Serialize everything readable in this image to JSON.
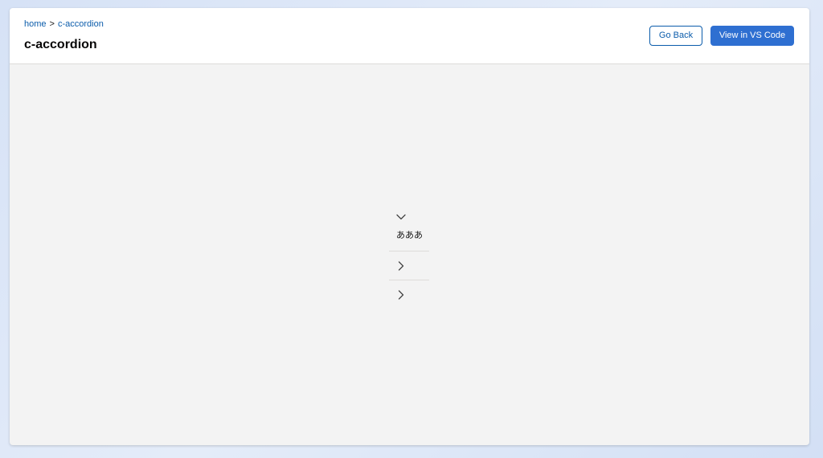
{
  "breadcrumb": {
    "home": "home",
    "separator": ">",
    "current": "c-accordion"
  },
  "header": {
    "title": "c-accordion",
    "go_back_label": "Go Back",
    "vscode_label": "View in VS Code"
  },
  "accordion": {
    "sections": [
      {
        "expanded": true,
        "content": "あああ",
        "icon": "chevron-down-icon"
      },
      {
        "expanded": false,
        "content": "",
        "icon": "chevron-right-icon"
      },
      {
        "expanded": false,
        "content": "",
        "icon": "chevron-right-icon"
      }
    ]
  },
  "colors": {
    "brand": "#2e6fd1",
    "link": "#0b5cab",
    "header_bg": "#ffffff",
    "canvas_bg": "#f3f3f3",
    "border": "#dddbda"
  }
}
